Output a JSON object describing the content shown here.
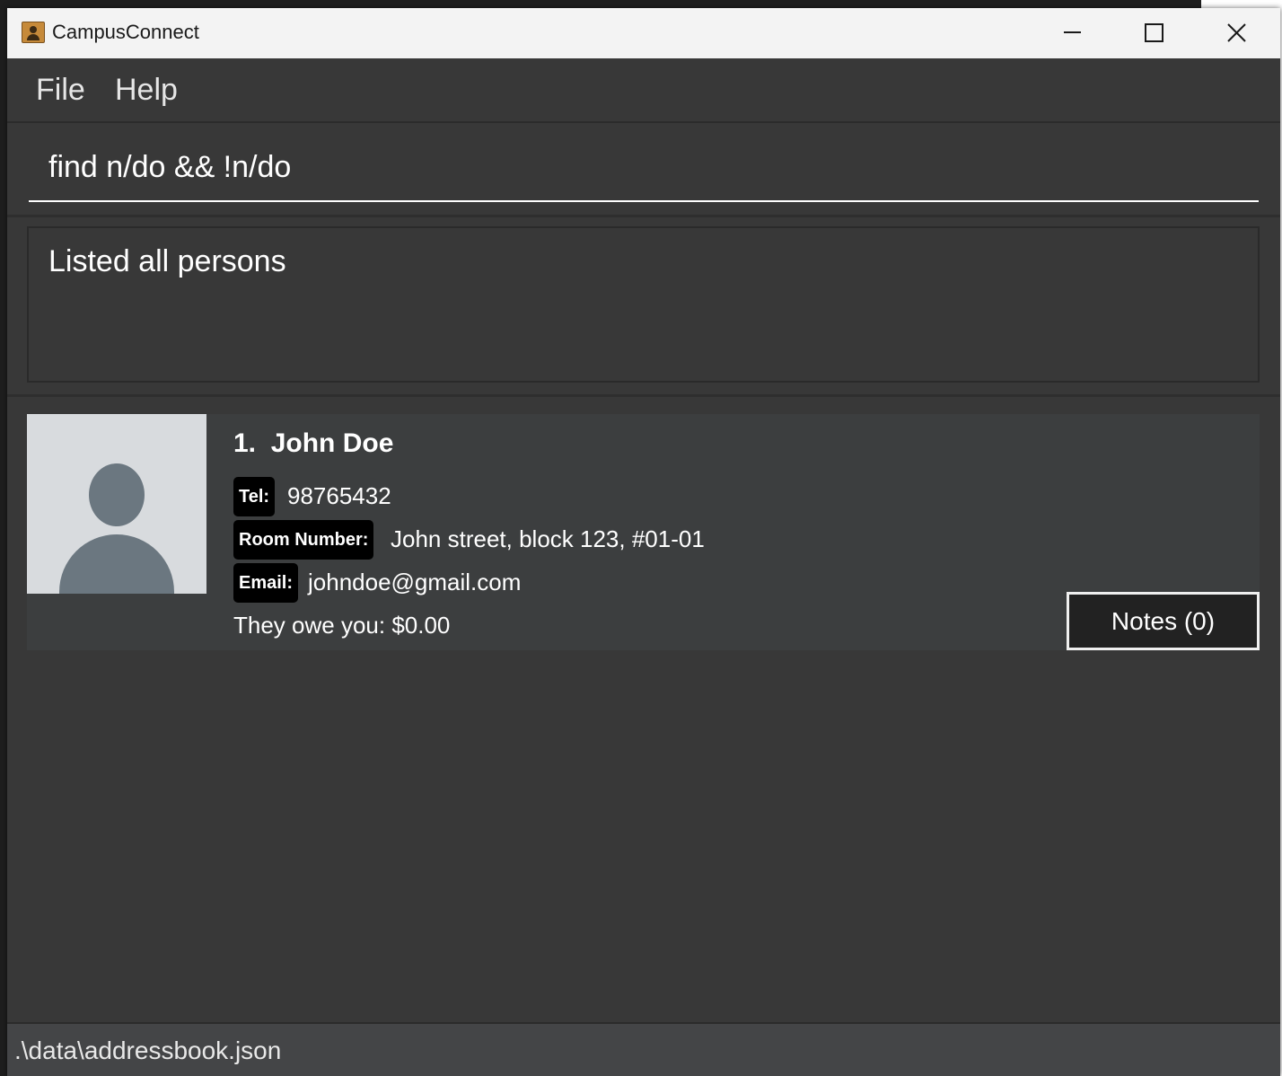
{
  "window": {
    "title": "CampusConnect",
    "icon": "address-book-icon",
    "controls": [
      "minimize-icon",
      "maximize-icon",
      "close-icon"
    ]
  },
  "menu": {
    "file_label": "File",
    "help_label": "Help"
  },
  "command": {
    "value": "find n/do && !n/do"
  },
  "result": {
    "message": "Listed all persons"
  },
  "persons": [
    {
      "index": "1.",
      "name": "John Doe",
      "tel_label": "Tel:",
      "tel": "98765432",
      "room_label": "Room Number:",
      "room": "John street, block 123, #01-01",
      "email_label": "Email:",
      "email": "johndoe@gmail.com",
      "owe": "They owe you: $0.00",
      "notes_label": "Notes (0)"
    }
  ],
  "status": {
    "path": ".\\data\\addressbook.json"
  },
  "colors": {
    "window_bg": "#383838",
    "card_bg": "#3c3e3f",
    "label_bg": "#000000",
    "titlebar_bg": "#f3f3f3",
    "statusbar_bg": "#444547"
  }
}
